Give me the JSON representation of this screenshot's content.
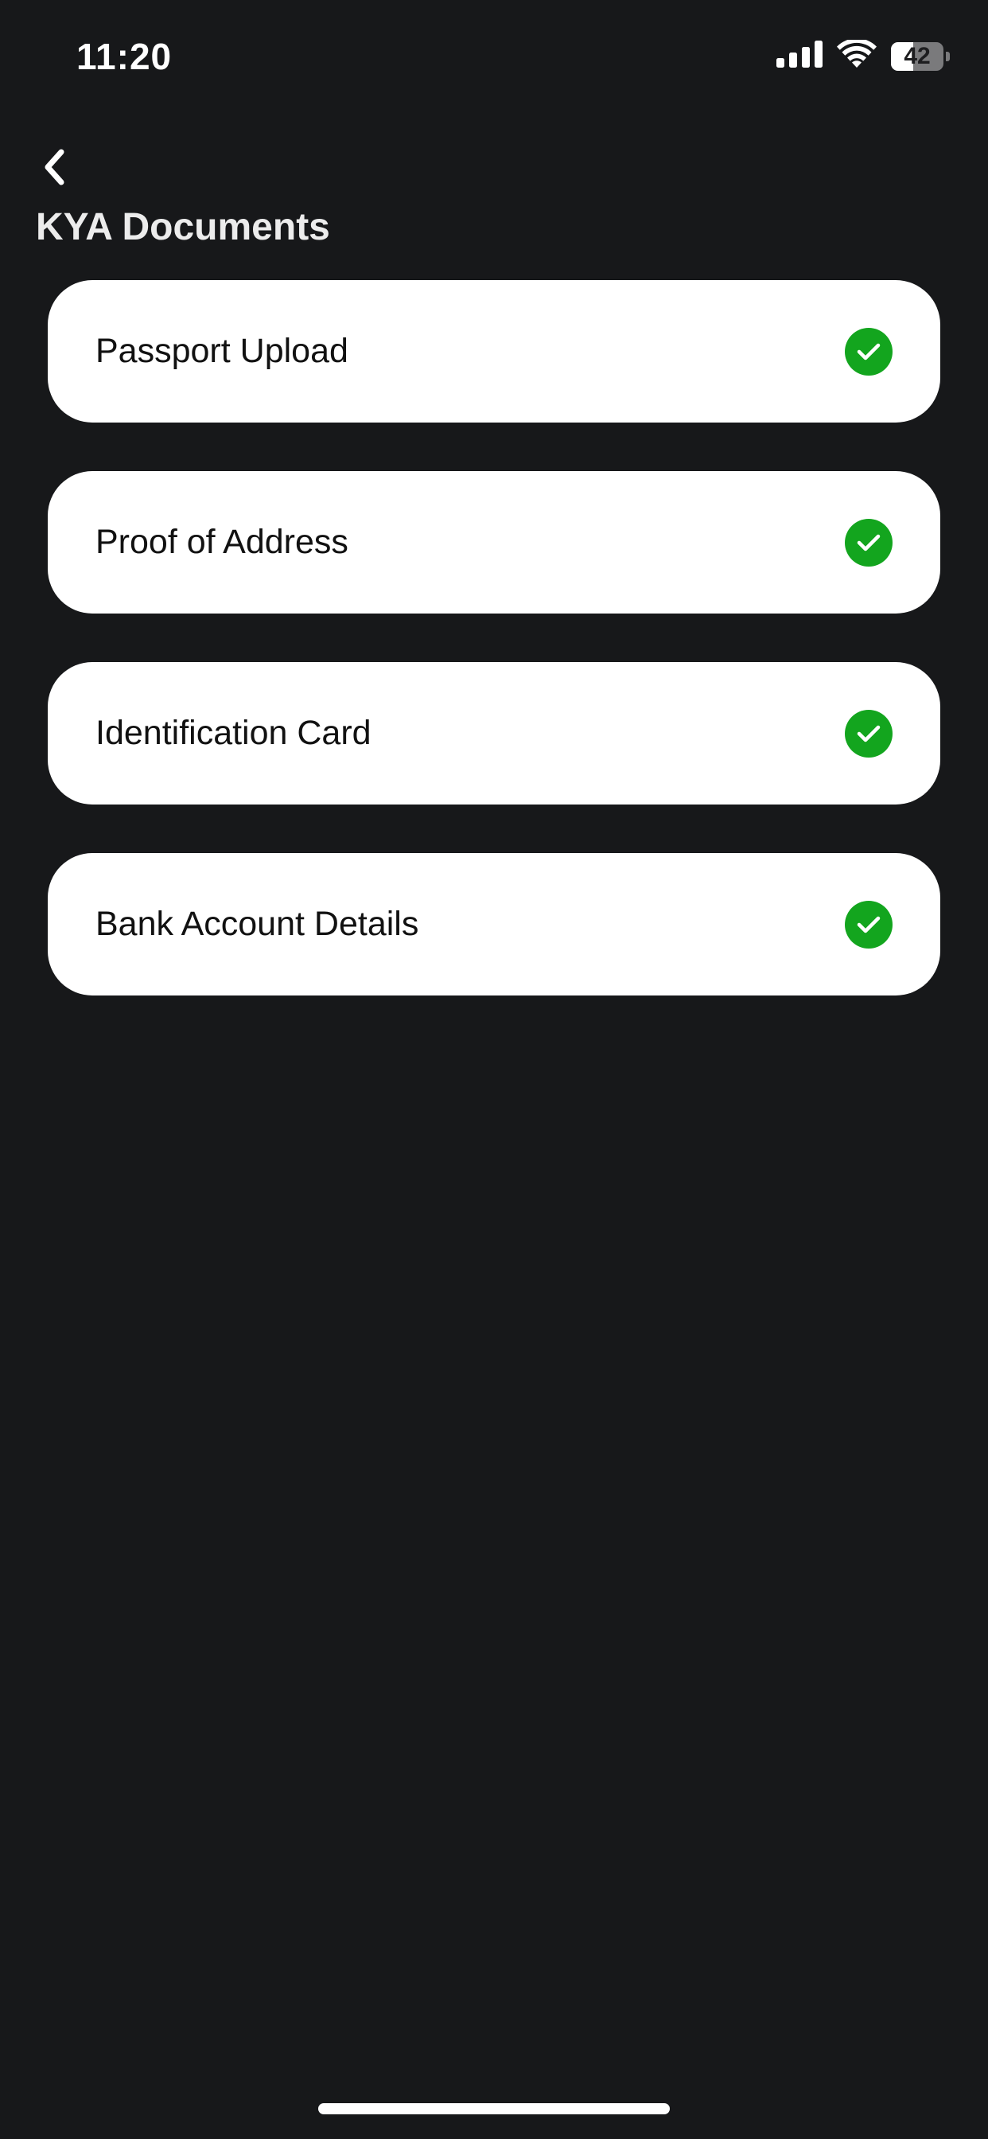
{
  "status_bar": {
    "time": "11:20",
    "battery_level": "42",
    "battery_fraction": 0.42,
    "icons": [
      "cellular-signal-icon",
      "wifi-icon",
      "battery-icon"
    ]
  },
  "header": {
    "back_icon": "chevron-left-icon",
    "title": "KYA Documents"
  },
  "documents": [
    {
      "label": "Passport Upload",
      "status": "complete",
      "icon": "check-circle-icon"
    },
    {
      "label": "Proof of Address",
      "status": "complete",
      "icon": "check-circle-icon"
    },
    {
      "label": "Identification Card",
      "status": "complete",
      "icon": "check-circle-icon"
    },
    {
      "label": "Bank Account Details",
      "status": "complete",
      "icon": "check-circle-icon"
    }
  ],
  "colors": {
    "background": "#17181a",
    "card": "#ffffff",
    "check": "#13a51e",
    "title": "#ececec"
  }
}
